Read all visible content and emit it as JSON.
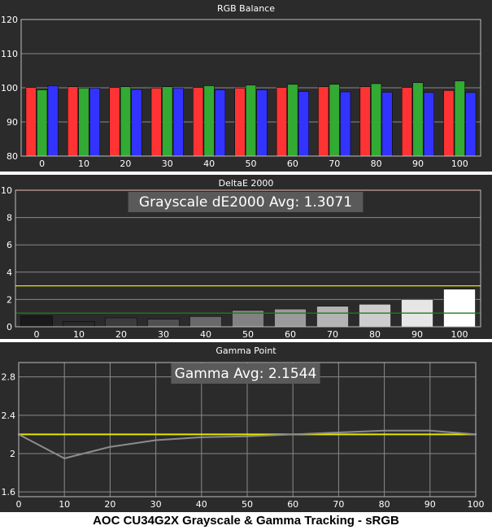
{
  "colors": {
    "background": "#2b2b2b",
    "plot_border": "#bdbdbd",
    "grid": "#8a8a8a",
    "text": "#ffffff",
    "red": "#ff3333",
    "green": "#33aa33",
    "blue": "#3333ff",
    "yellow": "#e6e600",
    "dark_green": "#1f7a1f",
    "top_red": "#ff3333",
    "gamma_line": "#8c8c8c",
    "banner_bg": "#5a5a5a"
  },
  "caption": "AOC CU34G2X Grayscale & Gamma Tracking - sRGB",
  "chart_data": [
    {
      "type": "bar",
      "title": "RGB Balance",
      "categories": [
        "0",
        "10",
        "20",
        "30",
        "40",
        "50",
        "60",
        "70",
        "80",
        "90",
        "100"
      ],
      "series": [
        {
          "color": "red",
          "values": [
            100.1,
            100.3,
            100.1,
            99.9,
            100.1,
            99.9,
            100.1,
            100.3,
            100.3,
            100.1,
            99.2
          ]
        },
        {
          "color": "green",
          "values": [
            99.4,
            99.9,
            100.3,
            100.3,
            100.6,
            100.8,
            101.0,
            101.0,
            101.2,
            101.5,
            102.0
          ]
        },
        {
          "color": "blue",
          "values": [
            100.6,
            99.9,
            99.5,
            99.9,
            99.4,
            99.4,
            98.9,
            98.8,
            98.7,
            98.6,
            98.6
          ]
        }
      ],
      "ylim": [
        80,
        120
      ],
      "yticks": [
        80,
        90,
        100,
        110,
        120
      ]
    },
    {
      "type": "bar",
      "title": "DeltaE 2000",
      "banner": "Grayscale dE2000 Avg: 1.3071",
      "categories": [
        "0",
        "10",
        "20",
        "30",
        "40",
        "50",
        "60",
        "70",
        "80",
        "90",
        "100"
      ],
      "values": [
        0.8,
        0.4,
        0.65,
        0.55,
        0.75,
        1.2,
        1.3,
        1.5,
        1.65,
        2.0,
        2.75
      ],
      "bar_colors": [
        "#1a1a1a",
        "#282828",
        "#3c3c3c",
        "#505050",
        "#696969",
        "#828282",
        "#9b9b9b",
        "#b4b4b4",
        "#cdcdcd",
        "#e6e6e6",
        "#ffffff"
      ],
      "reference_lines": [
        {
          "value": 1,
          "color": "dark_green"
        },
        {
          "value": 3,
          "color": "yellow"
        },
        {
          "value": 10,
          "color": "top_red"
        }
      ],
      "ylim": [
        0,
        10
      ],
      "yticks": [
        0,
        2,
        4,
        6,
        8,
        10
      ]
    },
    {
      "type": "line",
      "title": "Gamma Point",
      "banner": "Gamma Avg: 2.1544",
      "x": [
        0,
        10,
        20,
        30,
        40,
        50,
        60,
        70,
        80,
        90,
        100
      ],
      "xticks": [
        "0",
        "10",
        "20",
        "30",
        "40",
        "50",
        "60",
        "70",
        "80",
        "90",
        "100"
      ],
      "series": [
        {
          "color": "gamma_line",
          "values": [
            2.2,
            1.95,
            2.07,
            2.14,
            2.17,
            2.18,
            2.2,
            2.22,
            2.24,
            2.24,
            2.2
          ]
        }
      ],
      "target": 2.2,
      "ylim": [
        1.55,
        2.95
      ],
      "yticks": [
        1.6,
        2,
        2.4,
        2.8
      ]
    }
  ]
}
